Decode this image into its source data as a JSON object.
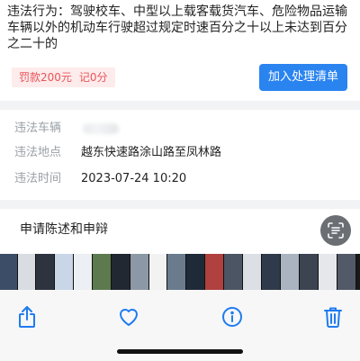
{
  "violation": {
    "text": "违法行为：驾驶校车、中型以上载客载货汽车、危险物品运输车辆以外的机动车行驶超过规定时速百分之十以上未达到百分之二十的",
    "fine_label": "罚款200元",
    "points_label": "记0分",
    "add_button_label": "加入处理清单"
  },
  "details": {
    "vehicle_label": "违法车辆",
    "location_label": "违法地点",
    "location_value": "越东快速路涂山路至凤林路",
    "time_label": "违法时间",
    "time_value": "2023-07-24 10:20"
  },
  "appeal": {
    "title": "申请陈述和申辩"
  },
  "photo_strip": {
    "thumb_colors": [
      "#3b4d67",
      "#d9dde2",
      "#2d3440",
      "#c9d6e8",
      "#eceff3",
      "#5c7a4e",
      "#222831",
      "#8c98a6",
      "#f2f2f2",
      "#6a7b8d",
      "#1e2a38",
      "#b0413e",
      "#4b5563",
      "#dcdfe3",
      "#2f3b4a",
      "#a9b4c0",
      "#3c4452",
      "#e5e7ea",
      "#515a66"
    ]
  },
  "toolbar": {
    "accent_color": "#1f7cf0",
    "icons": [
      "share-icon",
      "heart-icon",
      "info-icon",
      "trash-icon"
    ]
  }
}
